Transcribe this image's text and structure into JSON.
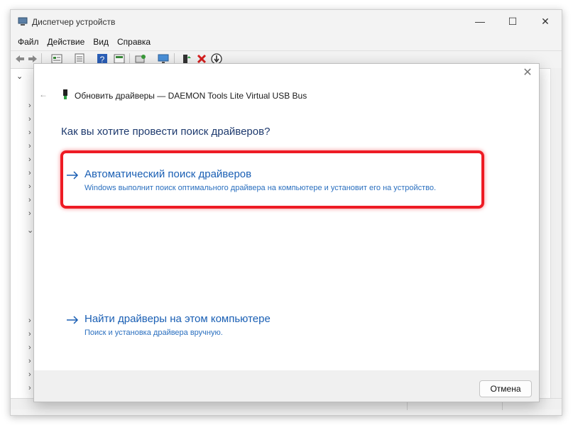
{
  "window": {
    "title": "Диспетчер устройств",
    "minimize_glyph": "—",
    "maximize_glyph": "☐",
    "close_glyph": "✕"
  },
  "menu": {
    "items": [
      "Файл",
      "Действие",
      "Вид",
      "Справка"
    ]
  },
  "toolbar": {
    "icons": [
      "back-icon",
      "forward-icon",
      "properties-icon",
      "device-list-icon",
      "help-icon",
      "view-icon",
      "scan-hardware-icon",
      "monitor-icon",
      "enable-device-icon",
      "uninstall-device-icon",
      "update-driver-icon"
    ]
  },
  "tree": {
    "root_glyph": "⌄",
    "collapsed_glyph": "›",
    "expanded_glyph": "⌄"
  },
  "dialog": {
    "close_glyph": "✕",
    "back_glyph": "←",
    "title": "Обновить драйверы — DAEMON Tools Lite Virtual USB Bus",
    "question": "Как вы хотите провести поиск драйверов?",
    "option_auto": {
      "title": "Автоматический поиск драйверов",
      "description": "Windows выполнит поиск оптимального драйвера на компьютере и установит его на устройство."
    },
    "option_manual": {
      "title": "Найти драйверы на этом компьютере",
      "description": "Поиск и установка драйвера вручную."
    },
    "cancel_label": "Отмена"
  },
  "colors": {
    "highlight": "#ee1b24",
    "link": "#1a5fb4",
    "heading": "#1e3a6e"
  }
}
